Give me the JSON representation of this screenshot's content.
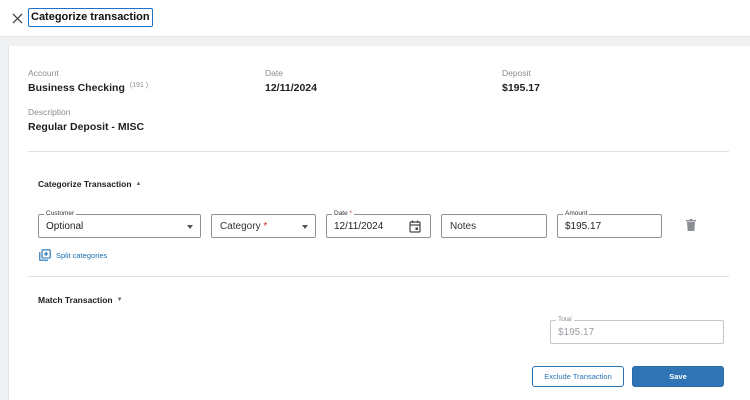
{
  "header": {
    "title": "Categorize transaction"
  },
  "summary": {
    "account_label": "Account",
    "account_value": "Business Checking",
    "account_suffix": "(191 )",
    "date_label": "Date",
    "date_value": "12/11/2024",
    "deposit_label": "Deposit",
    "deposit_value": "$195.17",
    "description_label": "Description",
    "description_value": "Regular Deposit - MISC"
  },
  "categorize": {
    "section_title": "Categorize Transaction",
    "customer_label": "Customer",
    "customer_value": "Optional",
    "category_placeholder": "Category",
    "required_mark": "*",
    "date_label": "Date",
    "date_value": "12/11/2024",
    "notes_placeholder": "Notes",
    "amount_label": "Amount",
    "amount_value": "$195.17",
    "split_label": "Split categories"
  },
  "match": {
    "section_title": "Match Transaction",
    "total_label": "Total",
    "total_value": "$195.17"
  },
  "actions": {
    "exclude_label": "Exclude Transaction",
    "save_label": "Save"
  },
  "colors": {
    "accent": "#2f74b5",
    "required": "#d32f2f"
  }
}
